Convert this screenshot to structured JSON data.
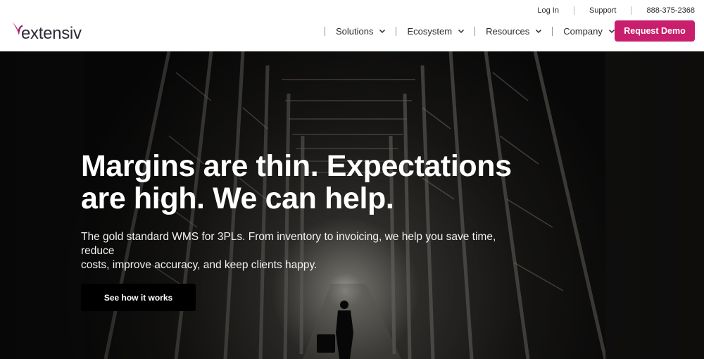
{
  "brand": {
    "name": "extensiv",
    "logo_icon": "bird-swoosh-icon",
    "accent_color": "#c81e6c"
  },
  "utility_nav": {
    "login": "Log In",
    "support": "Support",
    "phone": "888-375-2368"
  },
  "main_nav": {
    "items": [
      {
        "label": "Solutions",
        "icon": "chevron-down-icon"
      },
      {
        "label": "Ecosystem",
        "icon": "chevron-down-icon"
      },
      {
        "label": "Resources",
        "icon": "chevron-down-icon"
      },
      {
        "label": "Company",
        "icon": "chevron-down-icon"
      }
    ],
    "cta_label": "Request Demo"
  },
  "hero": {
    "title_line1": "Margins are thin. Expectations",
    "title_line2": "are high. We can help.",
    "subtitle_line1": "The gold standard WMS for 3PLs. From inventory to invoicing, we help you save time, reduce",
    "subtitle_line2": "costs, improve accuracy, and keep clients happy.",
    "button_label": "See how it works",
    "background": "warehouse-aisle-photo"
  }
}
